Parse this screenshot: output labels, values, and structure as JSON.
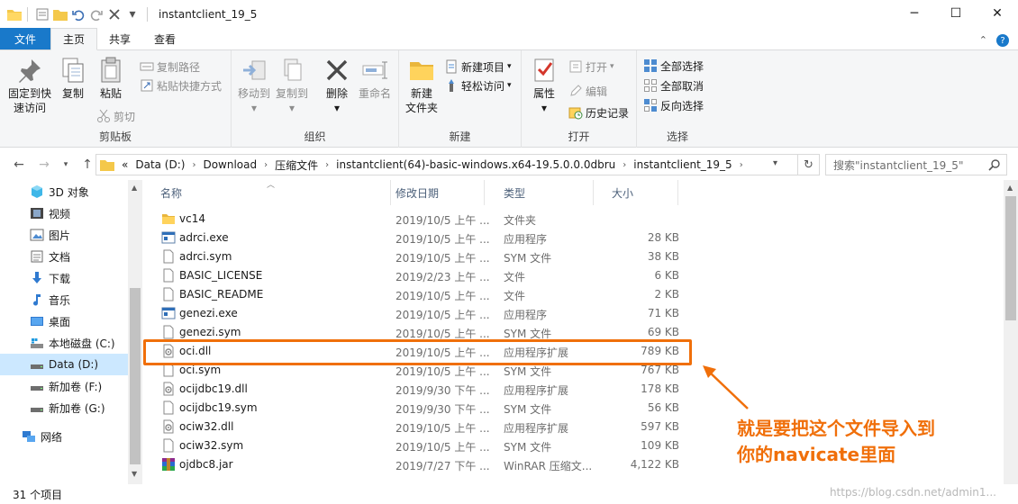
{
  "window": {
    "title": "instantclient_19_5",
    "minimize_glyph": "─",
    "maximize_glyph": "☐",
    "close_glyph": "✕"
  },
  "quick_access": {
    "dropdown_glyph": "▾"
  },
  "ribbon_tabs": {
    "file": "文件",
    "home": "主页",
    "share": "共享",
    "view": "查看"
  },
  "ribbon": {
    "clipboard": {
      "label": "剪贴板",
      "pin_line1": "固定到快",
      "pin_line2": "速访问",
      "copy": "复制",
      "paste": "粘贴",
      "copy_path": "复制路径",
      "paste_shortcut": "粘贴快捷方式",
      "cut": "剪切"
    },
    "organize": {
      "label": "组织",
      "move_to": "移动到",
      "copy_to": "复制到",
      "delete": "删除",
      "rename": "重命名"
    },
    "new": {
      "label": "新建",
      "new_folder_line1": "新建",
      "new_folder_line2": "文件夹",
      "new_item": "新建项目",
      "easy_access": "轻松访问"
    },
    "open": {
      "label": "打开",
      "properties": "属性",
      "open": "打开",
      "edit": "编辑",
      "history": "历史记录"
    },
    "select": {
      "label": "选择",
      "select_all": "全部选择",
      "select_none": "全部取消",
      "invert": "反向选择"
    }
  },
  "address": {
    "overflow": "«",
    "segments": [
      "Data (D:)",
      "Download",
      "压缩文件",
      "instantclient(64)-basic-windows.x64-19.5.0.0.0dbru",
      "instantclient_19_5"
    ],
    "search_placeholder": "搜索\"instantclient_19_5\""
  },
  "nav": [
    {
      "label": "3D 对象",
      "icon": "3d-objects-icon"
    },
    {
      "label": "视频",
      "icon": "video-icon"
    },
    {
      "label": "图片",
      "icon": "pictures-icon"
    },
    {
      "label": "文档",
      "icon": "documents-icon"
    },
    {
      "label": "下载",
      "icon": "download-icon"
    },
    {
      "label": "音乐",
      "icon": "music-icon"
    },
    {
      "label": "桌面",
      "icon": "desktop-icon"
    },
    {
      "label": "本地磁盘 (C:)",
      "icon": "drive-icon"
    },
    {
      "label": "Data (D:)",
      "icon": "drive-icon"
    },
    {
      "label": "新加卷 (F:)",
      "icon": "drive-icon"
    },
    {
      "label": "新加卷 (G:)",
      "icon": "drive-icon"
    },
    {
      "label": "网络",
      "icon": "network-icon"
    }
  ],
  "columns": {
    "name": "名称",
    "date": "修改日期",
    "type": "类型",
    "size": "大小"
  },
  "files": [
    {
      "name": "vc14",
      "date": "2019/10/5 上午 ...",
      "type": "文件夹",
      "size": "",
      "icon": "folder-icon"
    },
    {
      "name": "adrci.exe",
      "date": "2019/10/5 上午 ...",
      "type": "应用程序",
      "size": "28 KB",
      "icon": "exe-icon"
    },
    {
      "name": "adrci.sym",
      "date": "2019/10/5 上午 ...",
      "type": "SYM 文件",
      "size": "38 KB",
      "icon": "file-icon"
    },
    {
      "name": "BASIC_LICENSE",
      "date": "2019/2/23 上午 ...",
      "type": "文件",
      "size": "6 KB",
      "icon": "file-icon"
    },
    {
      "name": "BASIC_README",
      "date": "2019/10/5 上午 ...",
      "type": "文件",
      "size": "2 KB",
      "icon": "file-icon"
    },
    {
      "name": "genezi.exe",
      "date": "2019/10/5 上午 ...",
      "type": "应用程序",
      "size": "71 KB",
      "icon": "exe-icon"
    },
    {
      "name": "genezi.sym",
      "date": "2019/10/5 上午 ...",
      "type": "SYM 文件",
      "size": "69 KB",
      "icon": "file-icon"
    },
    {
      "name": "oci.dll",
      "date": "2019/10/5 上午 ...",
      "type": "应用程序扩展",
      "size": "789 KB",
      "icon": "dll-icon"
    },
    {
      "name": "oci.sym",
      "date": "2019/10/5 上午 ...",
      "type": "SYM 文件",
      "size": "767 KB",
      "icon": "file-icon"
    },
    {
      "name": "ocijdbc19.dll",
      "date": "2019/9/30 下午 ...",
      "type": "应用程序扩展",
      "size": "178 KB",
      "icon": "dll-icon"
    },
    {
      "name": "ocijdbc19.sym",
      "date": "2019/9/30 下午 ...",
      "type": "SYM 文件",
      "size": "56 KB",
      "icon": "file-icon"
    },
    {
      "name": "ociw32.dll",
      "date": "2019/10/5 上午 ...",
      "type": "应用程序扩展",
      "size": "597 KB",
      "icon": "dll-icon"
    },
    {
      "name": "ociw32.sym",
      "date": "2019/10/5 上午 ...",
      "type": "SYM 文件",
      "size": "109 KB",
      "icon": "file-icon"
    },
    {
      "name": "ojdbc8.jar",
      "date": "2019/7/27 下午 ...",
      "type": "WinRAR 压缩文...",
      "size": "4,122 KB",
      "icon": "winrar-icon"
    }
  ],
  "status": {
    "count": "31 个项目"
  },
  "watermark": "https://blog.csdn.net/admin1...",
  "annotation": {
    "line1": "就是要把这个文件导入到",
    "line2": "你的navicate里面",
    "color": "#f06f0a"
  }
}
